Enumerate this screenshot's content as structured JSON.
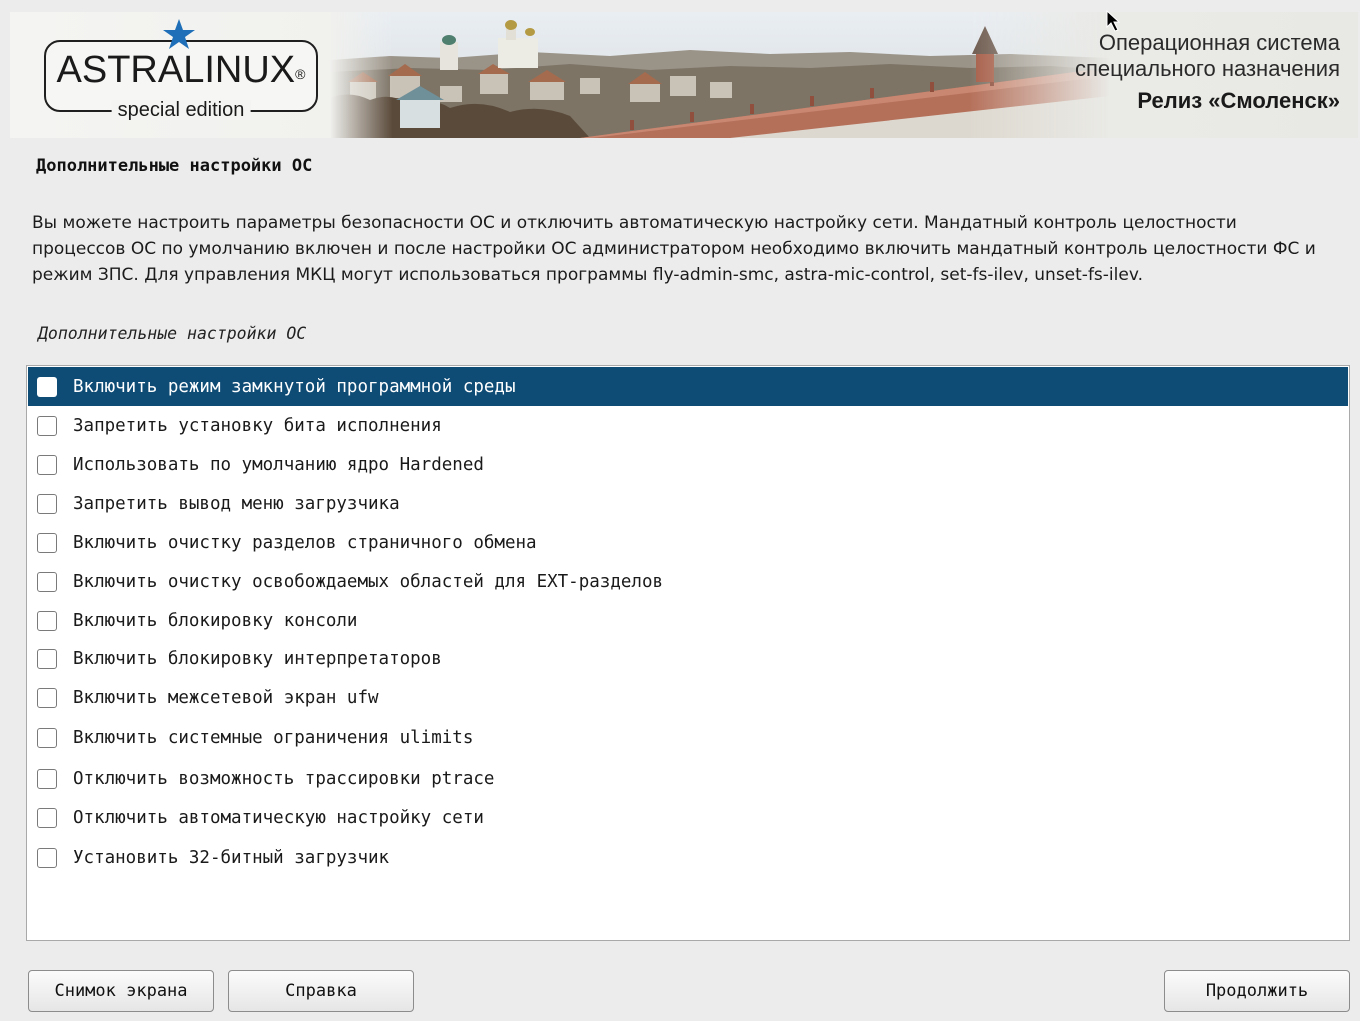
{
  "header": {
    "logo_text": "ASTRALINUX",
    "logo_registered": "®",
    "logo_subtitle": "special edition",
    "os_name_line1": "Операционная система",
    "os_name_line2": "специального назначения",
    "release": "Релиз «Смоленск»"
  },
  "page": {
    "heading": "Дополнительные настройки ОС",
    "description": "Вы можете настроить параметры безопасности ОС и отключить автоматическую настройку сети. Мандатный контроль целостности процессов ОС по умолчанию включен и после настройки ОС администратором необходимо включить мандатный контроль целостности ФС и режим ЗПС. Для управления МКЦ могут использоваться программы fly-admin-smc, astra-mic-control, set-fs-ilev, unset-fs-ilev.",
    "list_caption": "Дополнительные настройки ОС"
  },
  "options": [
    {
      "label": "Включить режим замкнутой программной среды",
      "checked": false,
      "selected": true
    },
    {
      "label": "Запретить установку бита исполнения",
      "checked": false,
      "selected": false
    },
    {
      "label": "Использовать по умолчанию ядро Hardened",
      "checked": false,
      "selected": false
    },
    {
      "label": "Запретить вывод меню загрузчика",
      "checked": false,
      "selected": false
    },
    {
      "label": "Включить очистку разделов страничного обмена",
      "checked": false,
      "selected": false
    },
    {
      "label": "Включить очистку освобождаемых областей для EXT-разделов",
      "checked": false,
      "selected": false
    },
    {
      "label": "Включить блокировку консоли",
      "checked": false,
      "selected": false
    },
    {
      "label": "Включить блокировку интерпретаторов",
      "checked": false,
      "selected": false
    },
    {
      "label": "Включить межсетевой экран ufw",
      "checked": false,
      "selected": false
    },
    {
      "label": "Включить системные ограничения ulimits",
      "checked": false,
      "selected": false
    },
    {
      "label": "Отключить возможность трассировки ptrace",
      "checked": false,
      "selected": false
    },
    {
      "label": "Отключить автоматическую настройку сети",
      "checked": false,
      "selected": false
    },
    {
      "label": "Установить 32-битный загрузчик",
      "checked": false,
      "selected": false
    }
  ],
  "buttons": {
    "screenshot": "Снимок экрана",
    "help": "Справка",
    "continue": "Продолжить"
  },
  "colors": {
    "selection": "#0f4c75",
    "star": "#1e6fb8",
    "background": "#ececec"
  }
}
